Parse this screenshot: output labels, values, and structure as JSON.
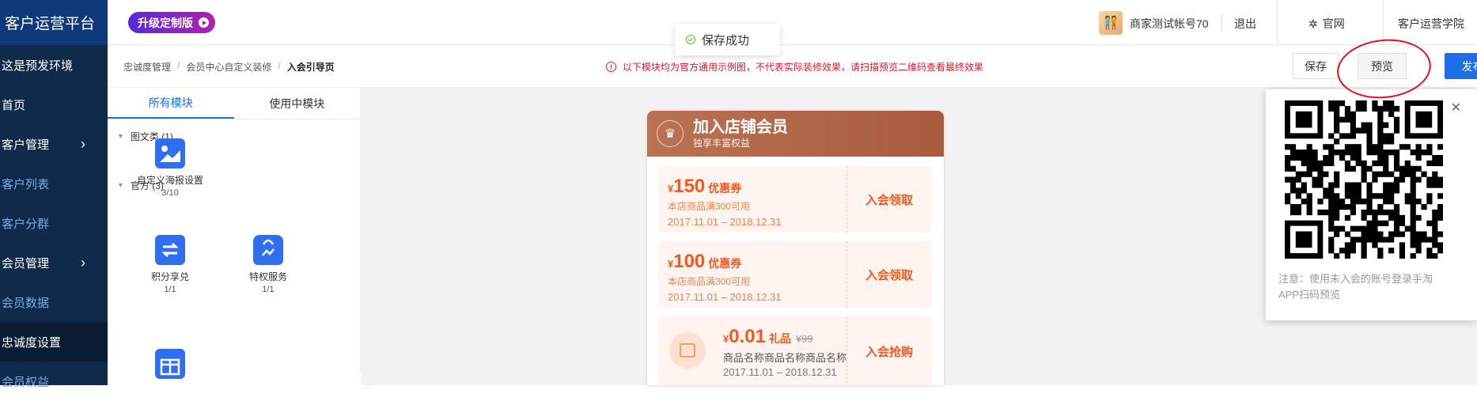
{
  "app": {
    "title": "客户运营平台"
  },
  "sidebar": {
    "items": [
      {
        "label": "这是预发环境",
        "type": "sub-top",
        "chevron": false
      },
      {
        "label": "首页",
        "type": "main",
        "chevron": false
      },
      {
        "label": "客户管理",
        "type": "main",
        "chevron": true
      },
      {
        "label": "客户列表",
        "type": "sub",
        "chevron": false
      },
      {
        "label": "客户分群",
        "type": "sub",
        "chevron": false
      },
      {
        "label": "会员管理",
        "type": "main",
        "chevron": true
      },
      {
        "label": "会员数据",
        "type": "sub",
        "chevron": false
      },
      {
        "label": "忠诚度设置",
        "type": "active",
        "chevron": false
      },
      {
        "label": "会员权益",
        "type": "sub",
        "chevron": false
      }
    ],
    "chevron": "›"
  },
  "topbar": {
    "upgrade_label": "升级定制版",
    "account": "商家测试帐号70",
    "logout": "退出",
    "official": "官网",
    "academy": "客户运营学院"
  },
  "toast": {
    "text": "保存成功"
  },
  "breadcrumb": {
    "items": [
      "忠诚度管理",
      "会员中心自定义装修",
      "入会引导页"
    ]
  },
  "notice": {
    "text": "以下模块均为官方通用示例图，不代表实际装修效果，请扫描预览二维码查看最终效果"
  },
  "actions": {
    "save": "保存",
    "preview": "预览",
    "publish": "发布"
  },
  "left_panel": {
    "tabs": [
      "所有模块",
      "使用中模块"
    ],
    "groups": [
      {
        "title": "图文类 (1)"
      },
      {
        "title": "官方 (3)"
      }
    ],
    "modules": [
      {
        "name": "自定义海报设置",
        "count": "3/10",
        "icon": "image-icon"
      },
      {
        "name": "积分享兑",
        "count": "1/1",
        "icon": "exchange-icon"
      },
      {
        "name": "特权服务",
        "count": "1/1",
        "icon": "bag-icon"
      },
      {
        "name": "",
        "count": "",
        "icon": "gift-icon"
      }
    ]
  },
  "phone": {
    "title": "加入店铺会员",
    "subtitle": "独享丰富权益",
    "coupons": [
      {
        "currency": "¥",
        "amount": "150",
        "unit": "优惠券",
        "condition": "本店商品满300可用",
        "date": "2017.11.01 – 2018.12.31",
        "action": "入会领取"
      },
      {
        "currency": "¥",
        "amount": "100",
        "unit": "优惠券",
        "condition": "本店商品满300可用",
        "date": "2017.11.01 – 2018.12.31",
        "action": "入会领取"
      }
    ],
    "gift": {
      "currency": "¥",
      "amount": "0.01",
      "unit": "礼品",
      "old_price": "¥99",
      "name": "商品名称商品名称商品名称",
      "date": "2017.11.01 – 2018.12.31",
      "action": "入会抢购"
    }
  },
  "preview_popup": {
    "note": "注意：使用未入会的账号登录手淘APP扫码预览"
  },
  "colors": {
    "primary": "#1a6fe8",
    "sidebar": "#0f2a4a",
    "coupon": "#f25a1e",
    "highlight": "#e0101e"
  }
}
